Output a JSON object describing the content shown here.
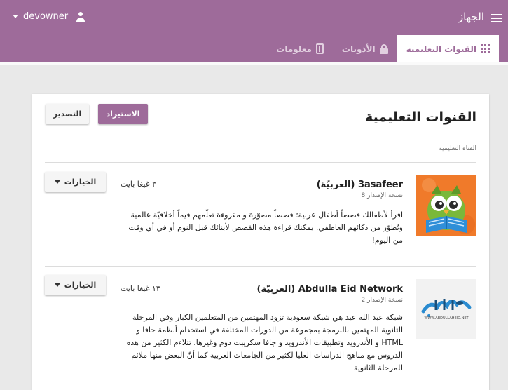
{
  "app": {
    "title": "الجهاز",
    "username": "devowner"
  },
  "tabs": [
    {
      "label": "القنوات التعليمية",
      "icon": "grid-icon",
      "active": true
    },
    {
      "label": "الأذونات",
      "icon": "lock-icon",
      "active": false
    },
    {
      "label": "معلومات",
      "icon": "info-icon",
      "active": false
    }
  ],
  "page": {
    "title": "القنوات التعليمية",
    "import_label": "الاستيراد",
    "export_label": "التصدير",
    "column_header": "القناة التعليمية"
  },
  "channels": [
    {
      "name": "3asafeer (العربيّة)",
      "version": "نسخة الإصدار 8",
      "size": "٣ غيغا بايت",
      "options_label": "الخيارات",
      "description": "اقرأ لأطفالك قصصاً أطفال عربية؛ قصصاً مصوّرة و مقروءة تعلّمهم قيماً أخلاقيّة عالمية وتُطوّر من ذكائهم العاطفي. يمكنك قراءة هذه القصص لأبنائك قبل النوم أو في أي وقت من اليوم!",
      "thumbnail": "owl-reading-book-image"
    },
    {
      "name": "Abdulla Eid Network (العربيّة)",
      "version": "نسخة الإصدار 2",
      "size": "١٣ غيغا بايت",
      "options_label": "الخيارات",
      "description": "شبكة عبد الله عيد هي شبكة سعودية تزود المهتمين من المتعلمين الكبار وفي المرحلة الثانوية المهتمين بالبرمجة بمجموعة من الدورات المختلفة في استخدام أنظمة جافا و HTML و الأندرويد وتطبيقات الأندرويد و جافا سكريبت دوم وغيرها. تتلاءم الكثير من هذه الدروس مع مناهج الدراسات العليا لكثير من الجامعات العربية كما أنّ البعض منها ملائم للمرحلة الثانوية",
      "thumbnail": "abdullaheid-logo-image",
      "logo_text": "WWW.ABDULLAHEID.NET"
    }
  ],
  "colors": {
    "brand": "#9e6b9a",
    "tab_inactive": "#e2cfe0"
  }
}
